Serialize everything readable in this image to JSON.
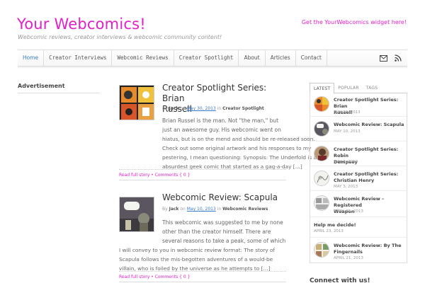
{
  "header": {
    "site_title": "Your Webcomics!",
    "tagline": "Webcomic reviews, creator interviews & webcomic community content!",
    "widget_link": "Get the YourWebcomics widget here!",
    "accent_color": "#e020c8"
  },
  "nav": {
    "items": [
      {
        "label": "Home"
      },
      {
        "label": "Creator Interviews"
      },
      {
        "label": "Webcomic Reviews"
      },
      {
        "label": "Creator Spotlight"
      },
      {
        "label": "About"
      },
      {
        "label": "Articles"
      },
      {
        "label": "Contact"
      }
    ],
    "icons": [
      "mail-icon",
      "rss-icon"
    ]
  },
  "left_sidebar": {
    "heading": "Advertisement"
  },
  "posts": [
    {
      "title_line1": "Creator Spotlight Series: Brian",
      "title_line2": "Russell",
      "author": "Jack",
      "on": "on",
      "date": "May 30, 2013",
      "in": "in",
      "category": "Creator Spotlight",
      "by": "By",
      "excerpt_lines": [
        "Brian Russel is the man. Not \"the man,\" but",
        "just an awesome guy. His webcomic went on",
        "hiatus, but is on the mend and should be re-released soon.",
        "Check out some original artwork and his responses to my",
        "pestering, I mean questioning: Synopsis: The Underfold is an",
        "absurdest geek comic that started as a gag-a-day […]"
      ],
      "read_full": "Read full story",
      "sep": "•",
      "comments": "Comments { 0 }"
    },
    {
      "title_line1": "Webcomic Review: Scapula",
      "author": "Jack",
      "on": "on",
      "date": "May 10, 2013",
      "in": "in",
      "category": "Webcomic Reviews",
      "by": "By",
      "excerpt_lines": [
        "This webcomic was suggested to me by none",
        "other than the creator himself. There are",
        "several reasons to take a peak, some of which",
        "I will convey to you in webcomic review format: The story of",
        "Scapula follows the mis-begotten adventures of a would-be",
        "villain, who is foiled by the universe as he attempts to […]"
      ],
      "read_full": "Read full story",
      "sep": "•",
      "comments": "Comments { 0 }"
    }
  ],
  "right_sidebar": {
    "tabs": [
      {
        "label": "LATEST",
        "active": true
      },
      {
        "label": "POPULAR",
        "active": false
      },
      {
        "label": "TAGS",
        "active": false
      }
    ],
    "latest": [
      {
        "title_line1": "Creator Spotlight Series: Brian",
        "title_line2": "Russell",
        "date": "MAY 30, 2013",
        "thumb": "comic"
      },
      {
        "title_line1": "Webcomic Review: Scapula",
        "title_line2": "",
        "date": "MAY 10, 2013",
        "thumb": "dark"
      },
      {
        "title_line1": "Creator Spotlight Series: Robin",
        "title_line2": "Dempsey",
        "date": "MAY 7, 2013",
        "thumb": "portrait"
      },
      {
        "title_line1": "Creator Spotlight Series:",
        "title_line2": "Christian Henry",
        "date": "MAY 3, 2013",
        "thumb": "sketch"
      },
      {
        "title_line1": "Webcomic Review – Registered",
        "title_line2": "Weapon",
        "date": "APRIL 25, 2013",
        "thumb": "strip"
      },
      {
        "title_line1": "Help me decide!",
        "title_line2": "",
        "date": "APRIL 23, 2013",
        "thumb": ""
      },
      {
        "title_line1": "Webcomic Review: By The",
        "title_line2": "Fingernails",
        "date": "APRIL 21, 2013",
        "thumb": "panels"
      }
    ],
    "connect_heading": "Connect with us!"
  }
}
